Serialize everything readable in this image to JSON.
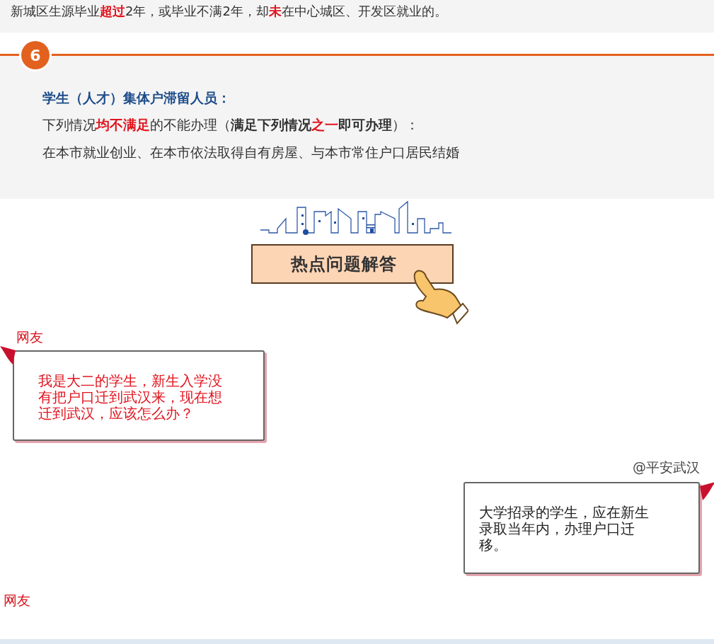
{
  "intro_text": [
    {
      "text": "新城区生源毕业",
      "kind": "plain"
    },
    {
      "text": "超过",
      "kind": "emphasis"
    },
    {
      "text": "2年，或毕业不满2年，却",
      "kind": "plain"
    },
    {
      "text": "未",
      "kind": "emphasis"
    },
    {
      "text": "在中心城区、开发区就业的。",
      "kind": "plain"
    }
  ],
  "section": {
    "number": "6",
    "heading": "学生（人才）集体户滞留人员：",
    "lines": [
      [
        {
          "text": "下列情况",
          "kind": "plain"
        },
        {
          "text": "均不满足",
          "kind": "emphasis"
        },
        {
          "text": "的不能办理（",
          "kind": "plain"
        },
        {
          "text": "满足下列情况",
          "kind": "strong"
        },
        {
          "text": "之一",
          "kind": "emphasis"
        },
        {
          "text": "即可办理",
          "kind": "strong"
        },
        {
          "text": "）：",
          "kind": "plain"
        }
      ],
      [
        {
          "text": "在本市就业创业、在本市依法取得自有房屋、与本市常住户口居民结婚",
          "kind": "plain"
        }
      ]
    ]
  },
  "faq_button": "热点问题解答",
  "messages": [
    {
      "sender": "网友",
      "kind": "question",
      "text": "我是大二的学生，新生入学没有把户口迁到武汉来，现在想迁到武汉，应该怎么办？"
    },
    {
      "sender": "@平安武汉",
      "kind": "answer",
      "text": "大学招录的学生，应在新生录取当年内，办理户口迁移。"
    }
  ],
  "next_sender": "网友"
}
